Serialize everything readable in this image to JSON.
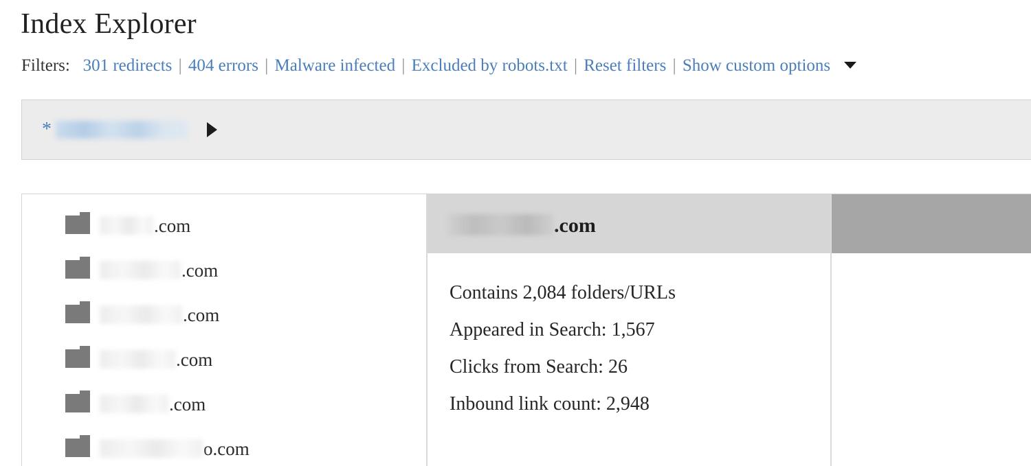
{
  "header": {
    "title": "Index Explorer",
    "filters_label": "Filters:",
    "separator": "|",
    "filters": [
      {
        "label": "301 redirects"
      },
      {
        "label": "404 errors"
      },
      {
        "label": "Malware infected"
      },
      {
        "label": "Excluded by robots.txt"
      },
      {
        "label": "Reset filters"
      },
      {
        "label": "Show custom options"
      }
    ],
    "dropdown_icon": "caret-down-icon"
  },
  "breadcrumb": {
    "root_marker": "*",
    "root_link_redacted": true,
    "expand_icon": "triangle-right-icon"
  },
  "folders": {
    "icon": "folder-icon",
    "items": [
      {
        "redacted_width": 78,
        "tld": ".com"
      },
      {
        "redacted_width": 118,
        "tld": ".com"
      },
      {
        "redacted_width": 120,
        "tld": ".com"
      },
      {
        "redacted_width": 110,
        "tld": ".com"
      },
      {
        "redacted_width": 100,
        "tld": ".com"
      },
      {
        "redacted_width": 150,
        "tld": "o.com"
      }
    ]
  },
  "detail": {
    "title_redacted_width": 153,
    "title_tld": ".com",
    "stats": [
      "Contains 2,084 folders/URLs",
      "Appeared in Search: 1,567",
      "Clicks from Search: 26",
      "Inbound link count: 2,948"
    ]
  },
  "colors": {
    "link": "#4a7ebb",
    "breadcrumb_bg": "#ececec",
    "detail_header_bg": "#d6d6d6",
    "third_header_bg": "#a6a6a6",
    "folder_icon": "#7a7a7a"
  }
}
